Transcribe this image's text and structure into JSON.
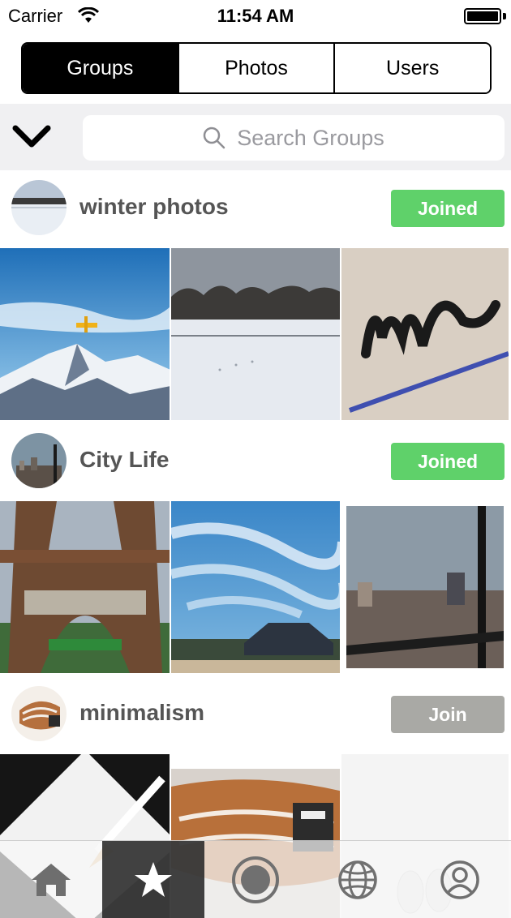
{
  "status_bar": {
    "carrier": "Carrier",
    "time": "11:54 AM"
  },
  "segments": {
    "groups": "Groups",
    "photos": "Photos",
    "users": "Users",
    "active": "Groups"
  },
  "search": {
    "placeholder": "Search Groups"
  },
  "groups": [
    {
      "name": "winter photos",
      "button": "Joined",
      "joined": true
    },
    {
      "name": "City Life",
      "button": "Joined",
      "joined": true
    },
    {
      "name": "minimalism",
      "button": "Join",
      "joined": false
    }
  ],
  "tab_bar": {
    "items": [
      "home-icon",
      "star-icon",
      "camera-icon",
      "globe-icon",
      "profile-icon"
    ],
    "active": "star-icon"
  },
  "colors": {
    "joined": "#5fd16a",
    "join": "#a9a9a5",
    "accent": "#000000"
  }
}
